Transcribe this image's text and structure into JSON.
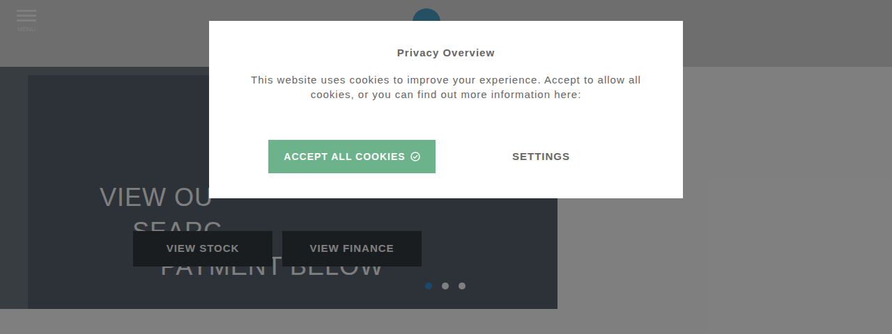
{
  "header": {
    "menu_label": "MENU"
  },
  "hero": {
    "lines": [
      "VIEW OU",
      "SEARC",
      "PAYMENT BELOW"
    ],
    "buttons": [
      "VIEW STOCK",
      "VIEW FINANCE"
    ],
    "dots": [
      {
        "selected": true
      },
      {
        "selected": false
      },
      {
        "selected": false
      }
    ]
  },
  "modal": {
    "title": "Privacy Overview",
    "text": "This website uses cookies to improve your experience. Accept to allow all cookies, or you can find out more information here:",
    "accept": "ACCEPT ALL COOKIES",
    "settings": "SETTINGS"
  }
}
